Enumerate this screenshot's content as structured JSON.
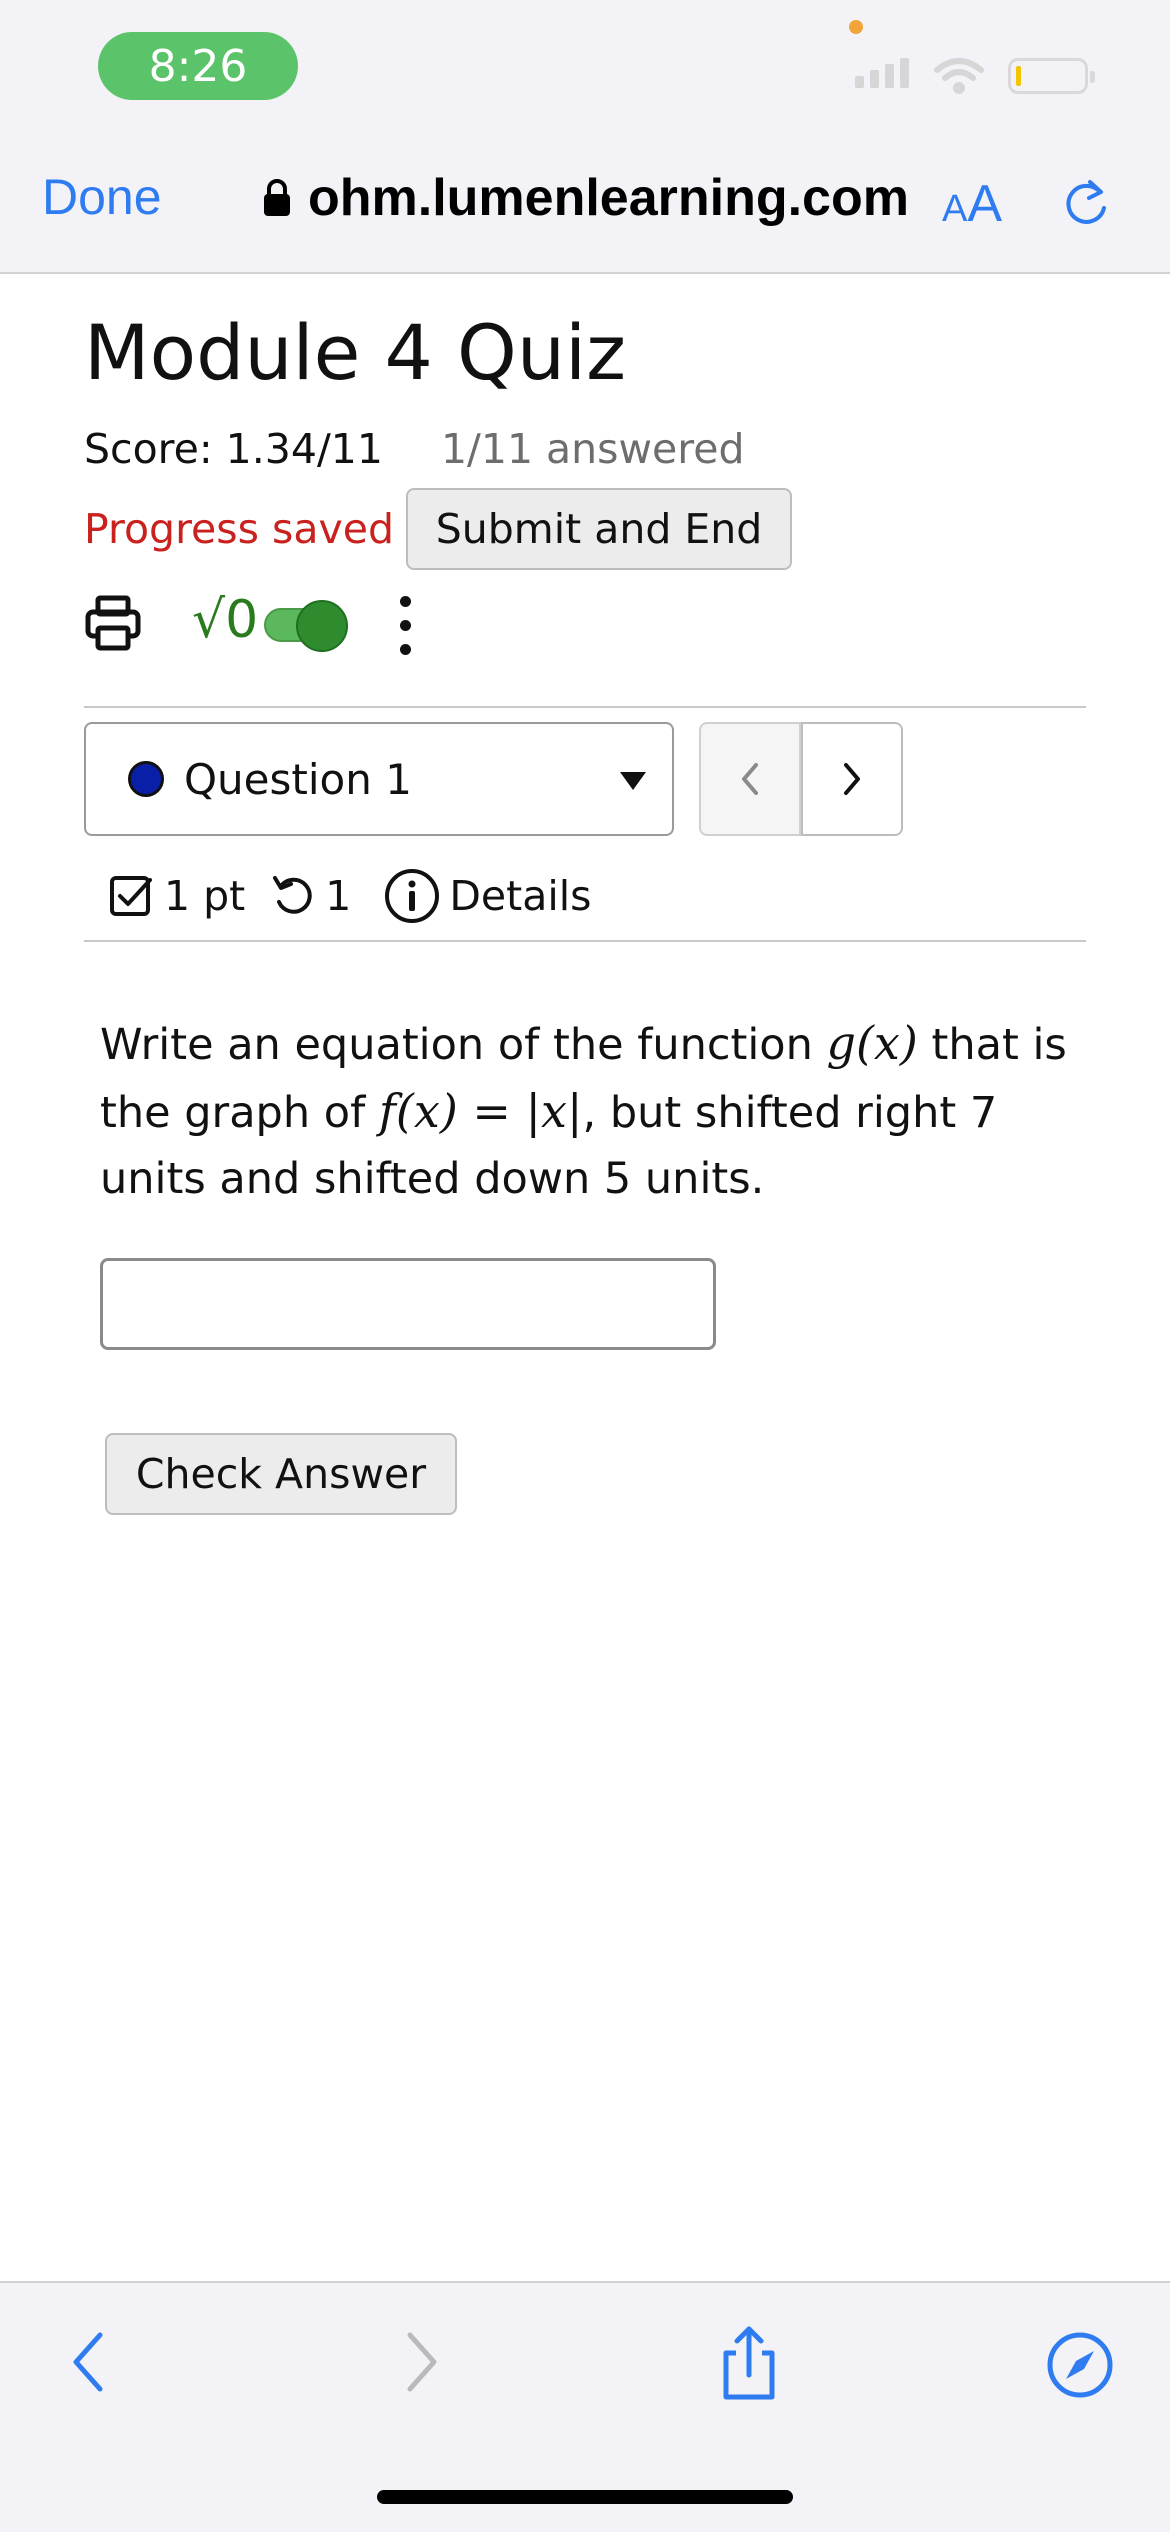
{
  "status_bar": {
    "time": "8:26",
    "colors": {
      "time_pill": "#5bc46a",
      "mic_dot": "#f2a33a",
      "battery_fill": "#f5c400"
    }
  },
  "browser": {
    "done_label": "Done",
    "url": "ohm.lumenlearning.com",
    "text_size_label_small": "A",
    "text_size_label_large": "A",
    "accent_color": "#2f7bf0",
    "icons": [
      "lock-icon",
      "reload-icon"
    ]
  },
  "quiz": {
    "title": "Module 4 Quiz",
    "score": "Score: 1.34/11",
    "answered": "1/11 answered",
    "progress_status": "Progress saved",
    "submit_label": "Submit and End",
    "math_toggle_symbol": "√0",
    "math_toggle_on": true,
    "tool_icons": [
      "print-icon",
      "math-entry-toggle",
      "kebab-menu-icon"
    ]
  },
  "question_nav": {
    "selected_question": "Question 1",
    "status_dot_color": "#0a1fa8",
    "prev_label": "<",
    "next_label": ">"
  },
  "question_meta": {
    "points": "1 pt",
    "attempts": "1",
    "details_label": "Details"
  },
  "question": {
    "text_1": "Write an equation of the function ",
    "math_g": "g(x)",
    "text_2": " that is the graph of ",
    "math_f": "f(x) = |x|",
    "text_3": ", but shifted right 7 units and shifted down 5 units.",
    "answer_value": "",
    "check_label": "Check Answer"
  },
  "toolbar": {
    "icons": [
      "back-icon",
      "forward-icon",
      "share-icon",
      "compass-icon"
    ]
  }
}
